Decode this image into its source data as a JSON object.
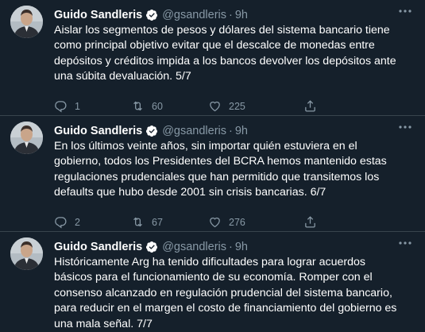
{
  "colors": {
    "background": "#15202b",
    "text": "#ffffff",
    "muted": "#8899a6",
    "divider": "#38444d",
    "verified": "#ffffff"
  },
  "icons": [
    "avatar-photo",
    "verified-icon",
    "more-icon",
    "reply-icon",
    "retweet-icon",
    "like-icon",
    "share-icon"
  ],
  "tweets": [
    {
      "name": "Guido Sandleris",
      "handle": "@gsandleris",
      "dot": "·",
      "time": "9h",
      "text": "Aislar los segmentos de pesos y dólares del sistema bancario tiene como principal objetivo evitar que el descalce de monedas entre depósitos y créditos impida a los bancos devolver los depósitos ante una súbita devaluación. 5/7",
      "replies": "1",
      "retweets": "60",
      "likes": "225"
    },
    {
      "name": "Guido Sandleris",
      "handle": "@gsandleris",
      "dot": "·",
      "time": "9h",
      "text": "En los últimos veinte años, sin importar quién estuviera en el gobierno, todos los Presidentes del BCRA hemos mantenido estas regulaciones prudenciales que han permitido que transitemos los defaults que hubo desde 2001 sin crisis bancarias. 6/7",
      "replies": "2",
      "retweets": "67",
      "likes": "276"
    },
    {
      "name": "Guido Sandleris",
      "handle": "@gsandleris",
      "dot": "·",
      "time": "9h",
      "text": "Históricamente Arg ha tenido dificultades para lograr acuerdos básicos para el funcionamiento de su economía. Romper con el consenso alcanzado en regulación prudencial del sistema bancario, para reducir en el margen el costo de financiamiento del gobierno es una mala señal. 7/7"
    }
  ]
}
